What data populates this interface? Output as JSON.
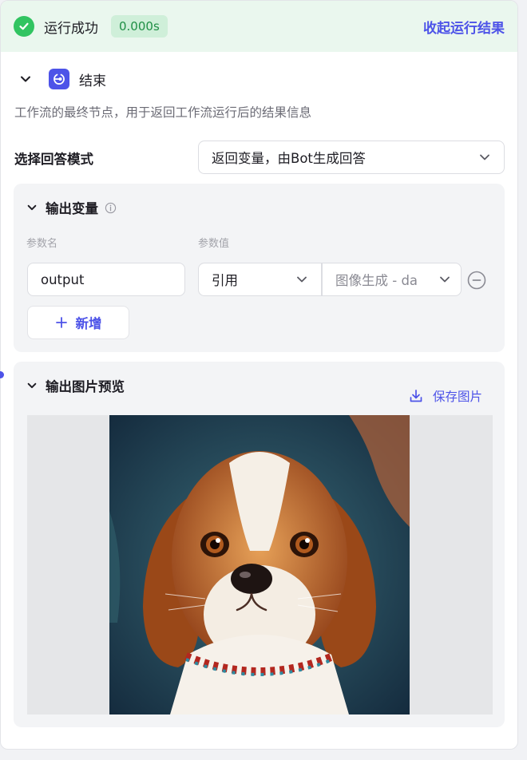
{
  "status": {
    "text": "运行成功",
    "duration": "0.000s",
    "collapse_label": "收起运行结果"
  },
  "node": {
    "title": "结束",
    "description": "工作流的最终节点，用于返回工作流运行后的结果信息"
  },
  "answer_mode": {
    "label": "选择回答模式",
    "selected": "返回变量，由Bot生成回答"
  },
  "output_vars": {
    "title": "输出变量",
    "col_name": "参数名",
    "col_value": "参数值",
    "rows": [
      {
        "name": "output",
        "ref_type": "引用",
        "ref_source": "图像生成 - da"
      }
    ],
    "add_label": "新增"
  },
  "image_preview": {
    "title": "输出图片预览",
    "save_label": "保存图片"
  },
  "colors": {
    "accent": "#4d53e8",
    "success": "#31c461",
    "success_bg": "#eaf7ee"
  }
}
